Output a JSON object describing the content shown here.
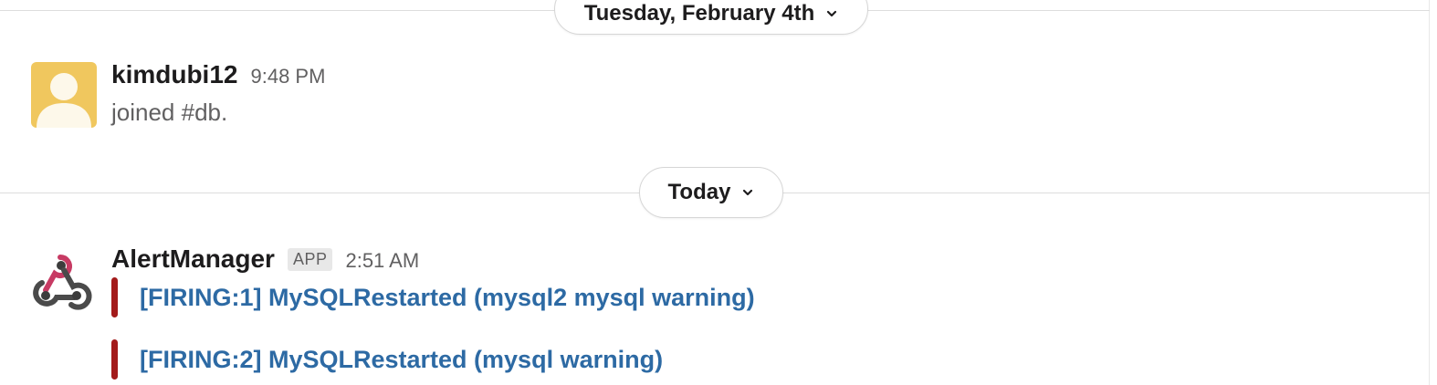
{
  "dividers": [
    {
      "label": "Tuesday, February 4th"
    },
    {
      "label": "Today"
    }
  ],
  "messages": [
    {
      "sender": "kimdubi12",
      "time": "9:48 PM",
      "text": "joined #db.",
      "avatar_color": "#f0c75e"
    },
    {
      "sender": "AlertManager",
      "badge": "APP",
      "time": "2:51 AM",
      "attachments": [
        {
          "title": "[FIRING:1] MySQLRestarted (mysql2 mysql warning)",
          "color": "#a31b1b"
        },
        {
          "title": "[FIRING:2] MySQLRestarted (mysql warning)",
          "color": "#a31b1b"
        }
      ]
    }
  ],
  "colors": {
    "link": "#2d6aa4",
    "alert_bar": "#a31b1b",
    "muted_text": "#616061"
  },
  "icons": {
    "divider_chevron": "chevron-down-icon",
    "app_avatar": "webhook-icon",
    "user_avatar": "default-user-icon"
  }
}
